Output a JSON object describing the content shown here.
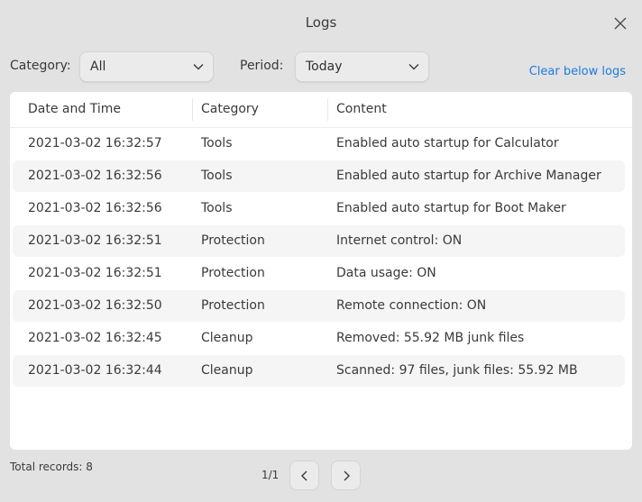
{
  "window": {
    "title": "Logs",
    "close_icon": "close-icon"
  },
  "filters": {
    "category_label": "Category:",
    "category_value": "All",
    "period_label": "Period:",
    "period_value": "Today",
    "clear_label": "Clear below logs"
  },
  "table": {
    "columns": [
      "Date and Time",
      "Category",
      "Content"
    ],
    "rows": [
      {
        "datetime": "2021-03-02 16:32:57",
        "category": "Tools",
        "content": "Enabled auto startup for Calculator"
      },
      {
        "datetime": "2021-03-02 16:32:56",
        "category": "Tools",
        "content": "Enabled auto startup for Archive Manager"
      },
      {
        "datetime": "2021-03-02 16:32:56",
        "category": "Tools",
        "content": "Enabled auto startup for Boot Maker"
      },
      {
        "datetime": "2021-03-02 16:32:51",
        "category": "Protection",
        "content": "Internet control: ON"
      },
      {
        "datetime": "2021-03-02 16:32:51",
        "category": "Protection",
        "content": "Data usage: ON"
      },
      {
        "datetime": "2021-03-02 16:32:50",
        "category": "Protection",
        "content": "Remote connection: ON"
      },
      {
        "datetime": "2021-03-02 16:32:45",
        "category": "Cleanup",
        "content": "Removed: 55.92 MB junk files"
      },
      {
        "datetime": "2021-03-02 16:32:44",
        "category": "Cleanup",
        "content": "Scanned: 97 files, junk files: 55.92 MB"
      }
    ]
  },
  "footer": {
    "total_records": "Total records: 8",
    "page_indicator": "1/1",
    "prev_icon": "chevron-left-icon",
    "next_icon": "chevron-right-icon"
  },
  "colors": {
    "background": "#e2e2e2",
    "panel": "#ffffff",
    "accent_link": "#1f7ae0",
    "row_alt": "#f5f5f5"
  }
}
